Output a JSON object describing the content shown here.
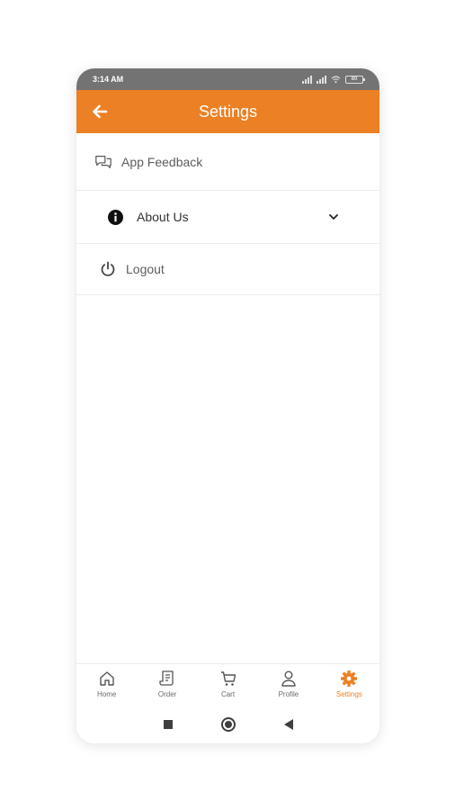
{
  "status_bar": {
    "time": "3:14 AM",
    "battery": "80"
  },
  "app_bar": {
    "title": "Settings"
  },
  "menu": {
    "feedback_label": "App Feedback",
    "about_label": "About Us",
    "logout_label": "Logout"
  },
  "bottom_nav": [
    {
      "label": "Home",
      "icon": "home-icon"
    },
    {
      "label": "Order",
      "icon": "receipt-icon"
    },
    {
      "label": "Cart",
      "icon": "cart-icon"
    },
    {
      "label": "Profile",
      "icon": "user-icon"
    },
    {
      "label": "Settings",
      "icon": "gear-icon",
      "active": true
    }
  ],
  "colors": {
    "accent": "#ec8024",
    "status_bar": "#737373"
  }
}
